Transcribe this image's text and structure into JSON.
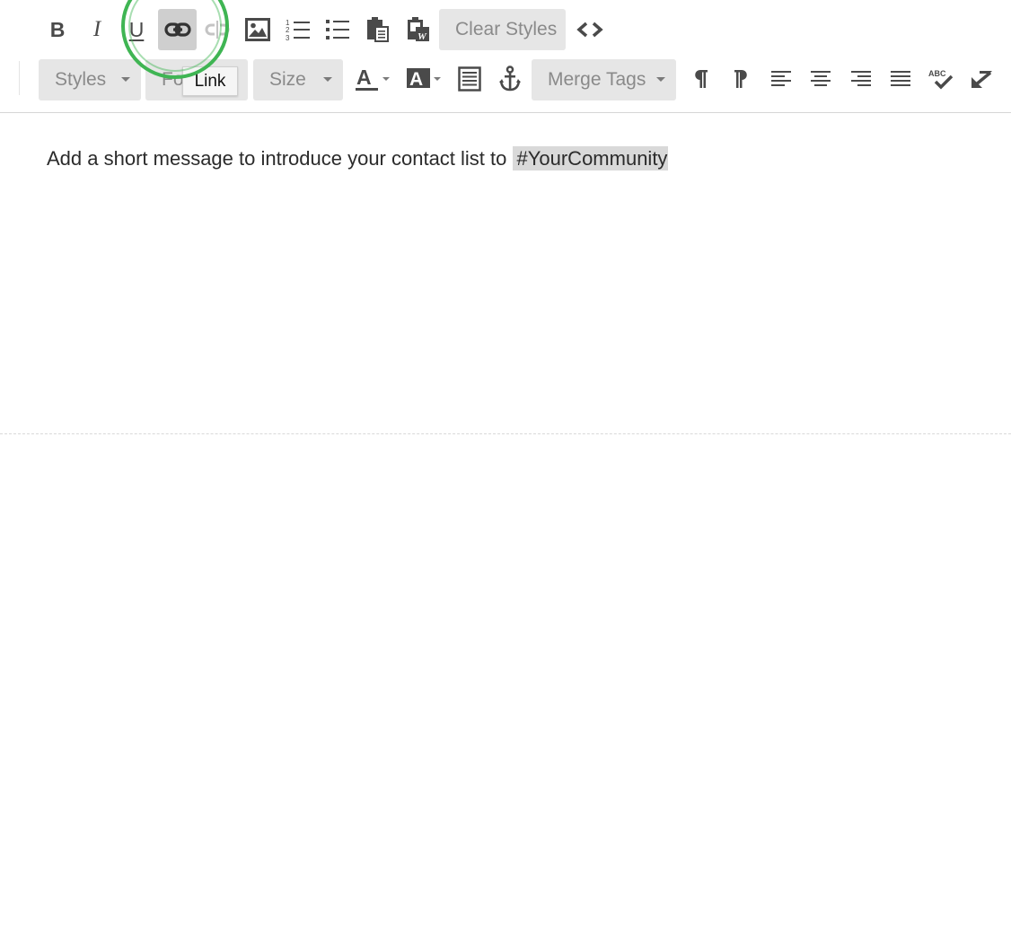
{
  "toolbar_row1": {
    "bold": {
      "label": "B",
      "icon": "bold-icon"
    },
    "italic": {
      "label": "I",
      "icon": "italic-icon"
    },
    "underline": {
      "label": "U",
      "icon": "underline-icon"
    },
    "link": {
      "icon": "link-icon",
      "state": "active"
    },
    "unlink": {
      "icon": "unlink-icon",
      "state": "disabled"
    },
    "image": {
      "icon": "image-icon"
    },
    "numbered_list": {
      "icon": "numbered-list-icon"
    },
    "bulleted_list": {
      "icon": "bulleted-list-icon"
    },
    "paste": {
      "icon": "paste-icon"
    },
    "paste_word": {
      "icon": "paste-from-word-icon"
    },
    "clear_styles_label": "Clear Styles",
    "source": {
      "icon": "source-code-icon"
    }
  },
  "toolbar_row2": {
    "styles_label": "Styles",
    "font_label": "Fo",
    "size_label": "Size",
    "text_color": {
      "label": "A",
      "icon": "text-color-icon"
    },
    "bg_color": {
      "label": "A",
      "icon": "background-color-icon"
    },
    "block": {
      "icon": "block-icon"
    },
    "anchor": {
      "icon": "anchor-icon"
    },
    "merge_tags_label": "Merge Tags",
    "ltr": {
      "icon": "paragraph-ltr-icon"
    },
    "rtl": {
      "icon": "paragraph-rtl-icon"
    },
    "align_left": {
      "icon": "align-left-icon"
    },
    "align_center": {
      "icon": "align-center-icon"
    },
    "align_right": {
      "icon": "align-right-icon"
    },
    "justify": {
      "icon": "justify-icon"
    },
    "spellcheck": {
      "label": "ABC",
      "icon": "spellcheck-icon"
    },
    "undo": {
      "icon": "undo-arrow-icon"
    }
  },
  "tooltip": {
    "text": "Link"
  },
  "content": {
    "message_text": "Add a short message to introduce your contact list to ",
    "merge_tag_text": "#YourCommunity"
  },
  "colors": {
    "icon": "#4a4a4a",
    "button_bg": "#e6e6e6",
    "active_bg": "#cfcfcf",
    "highlight_ring": "#3fb553",
    "merge_tag_bg": "#d9d9d9"
  }
}
